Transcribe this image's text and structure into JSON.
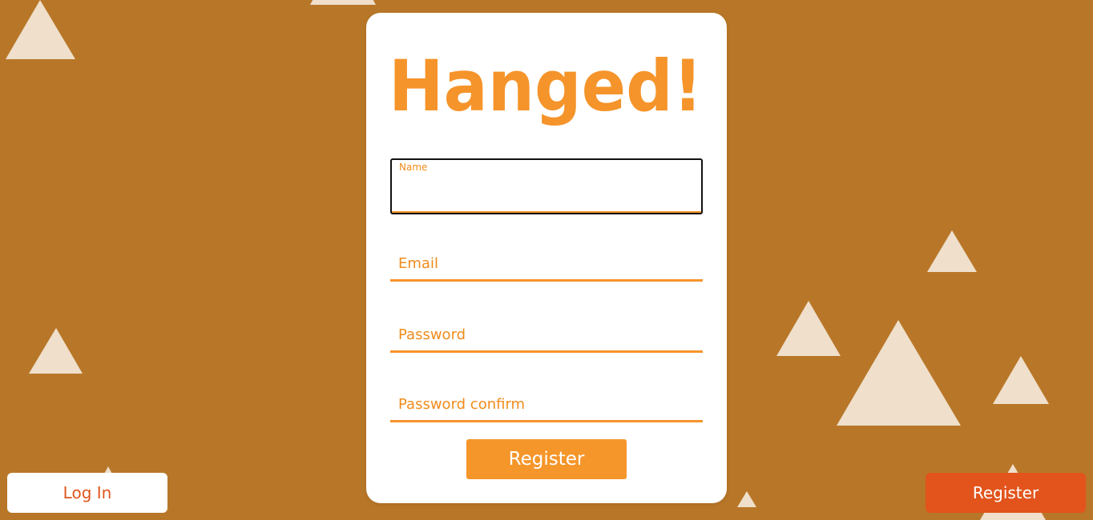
{
  "logo": {
    "text": "Hanged!",
    "color": "#f5942a"
  },
  "form": {
    "name": {
      "label": "Name",
      "value": ""
    },
    "email": {
      "label": "Email"
    },
    "password": {
      "label": "Password"
    },
    "password_confirm": {
      "label": "Password confirm"
    },
    "submit_label": "Register"
  },
  "footer": {
    "login_label": "Log In",
    "register_label": "Register"
  },
  "colors": {
    "background": "#b87728",
    "accent": "#f5942a",
    "triangle": "#f1e0cc",
    "corner_register": "#e2541c"
  }
}
